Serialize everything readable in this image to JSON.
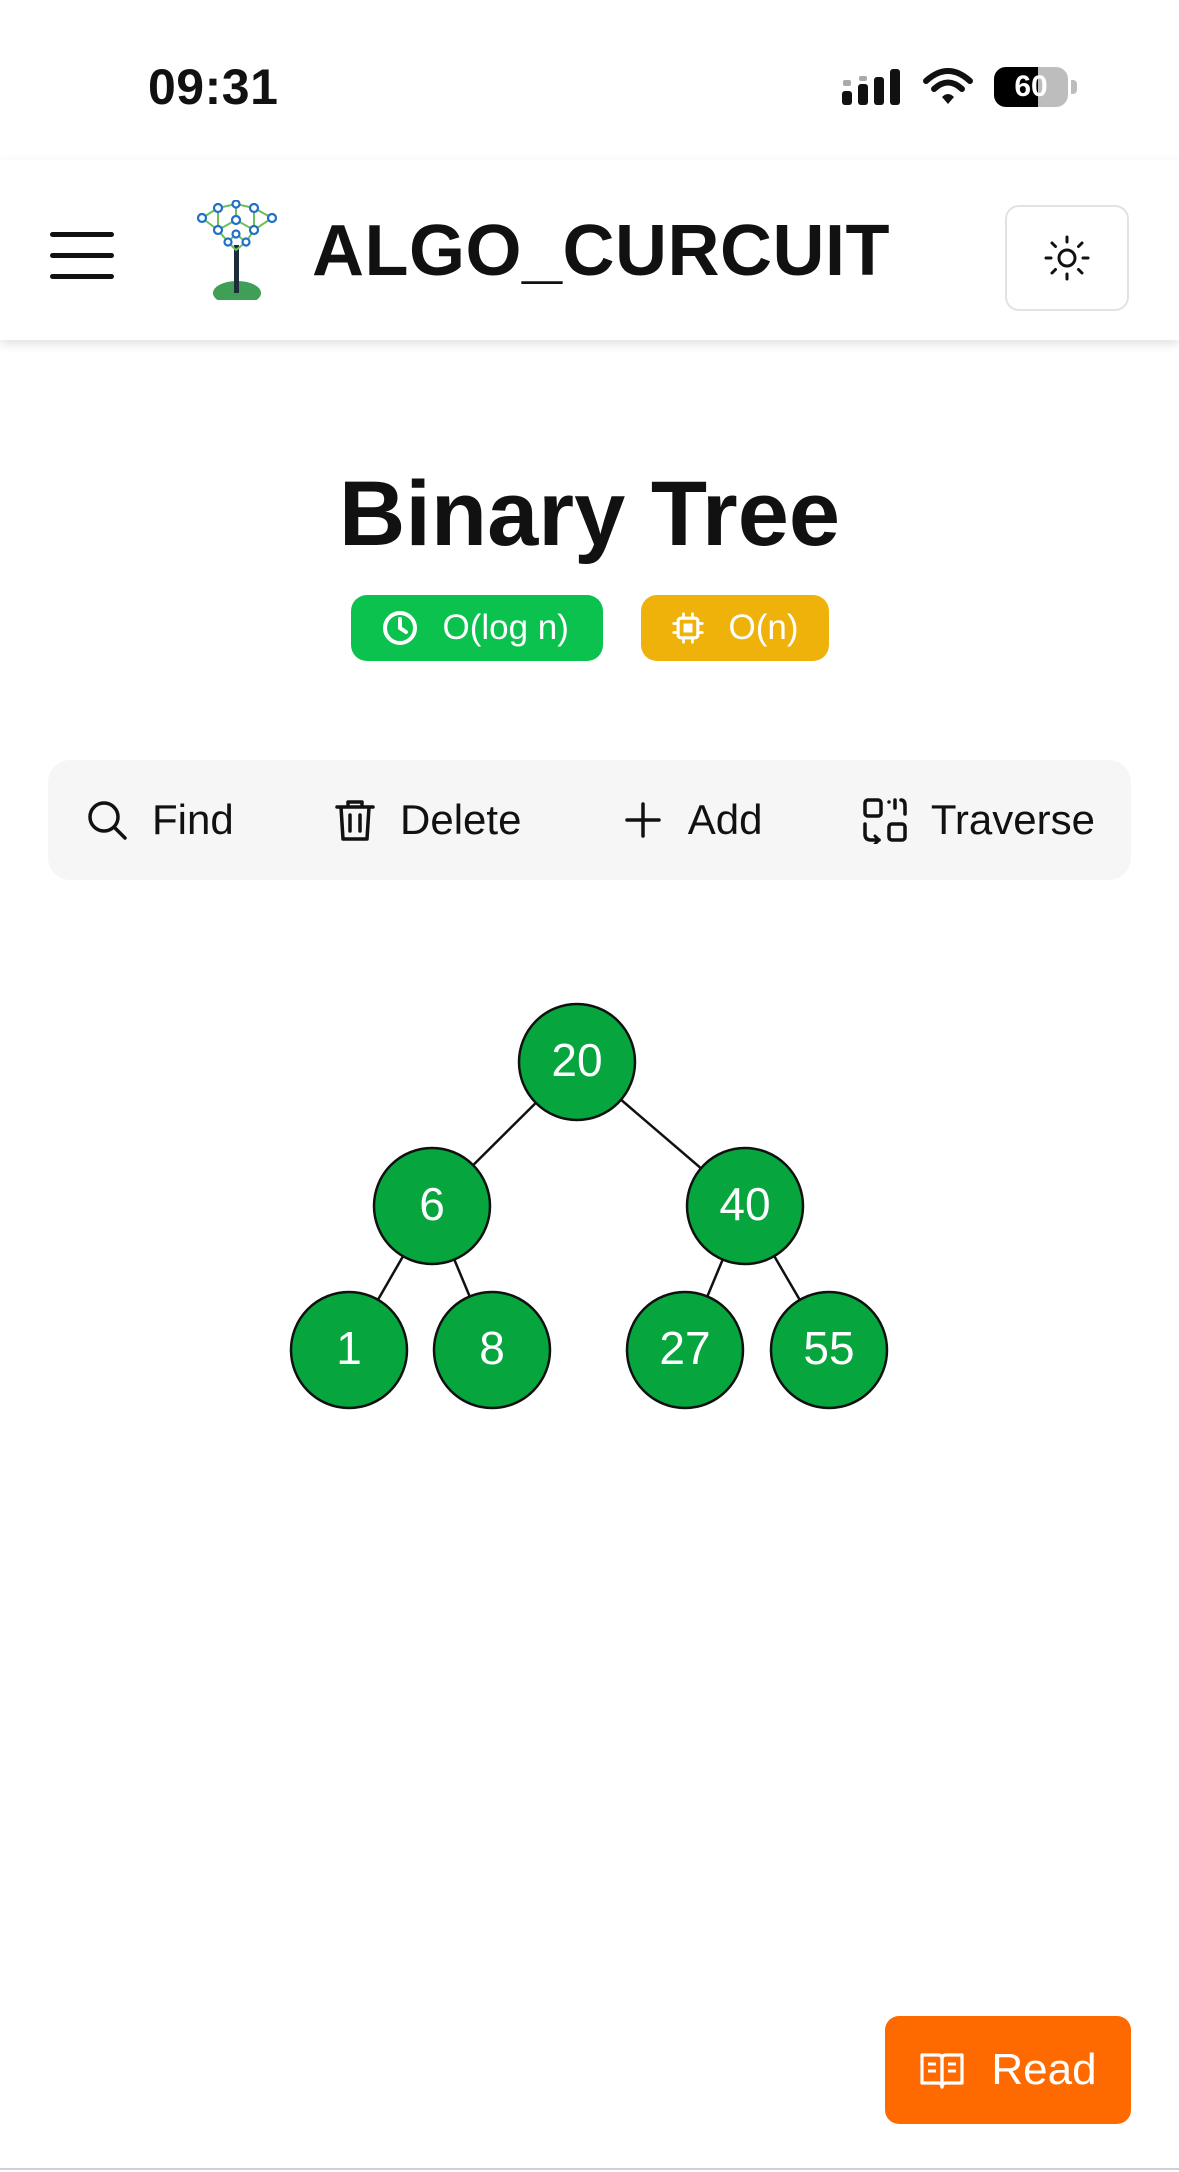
{
  "status_bar": {
    "time": "09:31",
    "battery": "60",
    "battery_level": 0.6
  },
  "header": {
    "title": "ALGO_CURCUIT",
    "menu_icon": "hamburger-menu-icon",
    "logo_icon": "tree-logo-icon",
    "theme_icon": "sun-icon"
  },
  "page": {
    "title": "Binary Tree",
    "time_complexity": "O(log n)",
    "space_complexity": "O(n)"
  },
  "toolbar": {
    "find": "Find",
    "delete": "Delete",
    "add": "Add",
    "traverse": "Traverse"
  },
  "tree": {
    "node_color": "#06a53e",
    "root": "20",
    "left": "6",
    "right": "40",
    "left_left": "1",
    "left_right": "8",
    "right_left": "27",
    "right_right": "55"
  },
  "read_button": {
    "label": "Read"
  },
  "colors": {
    "time_badge": "#0cc24f",
    "space_badge": "#efb20a",
    "read_button": "#ff6a00"
  }
}
